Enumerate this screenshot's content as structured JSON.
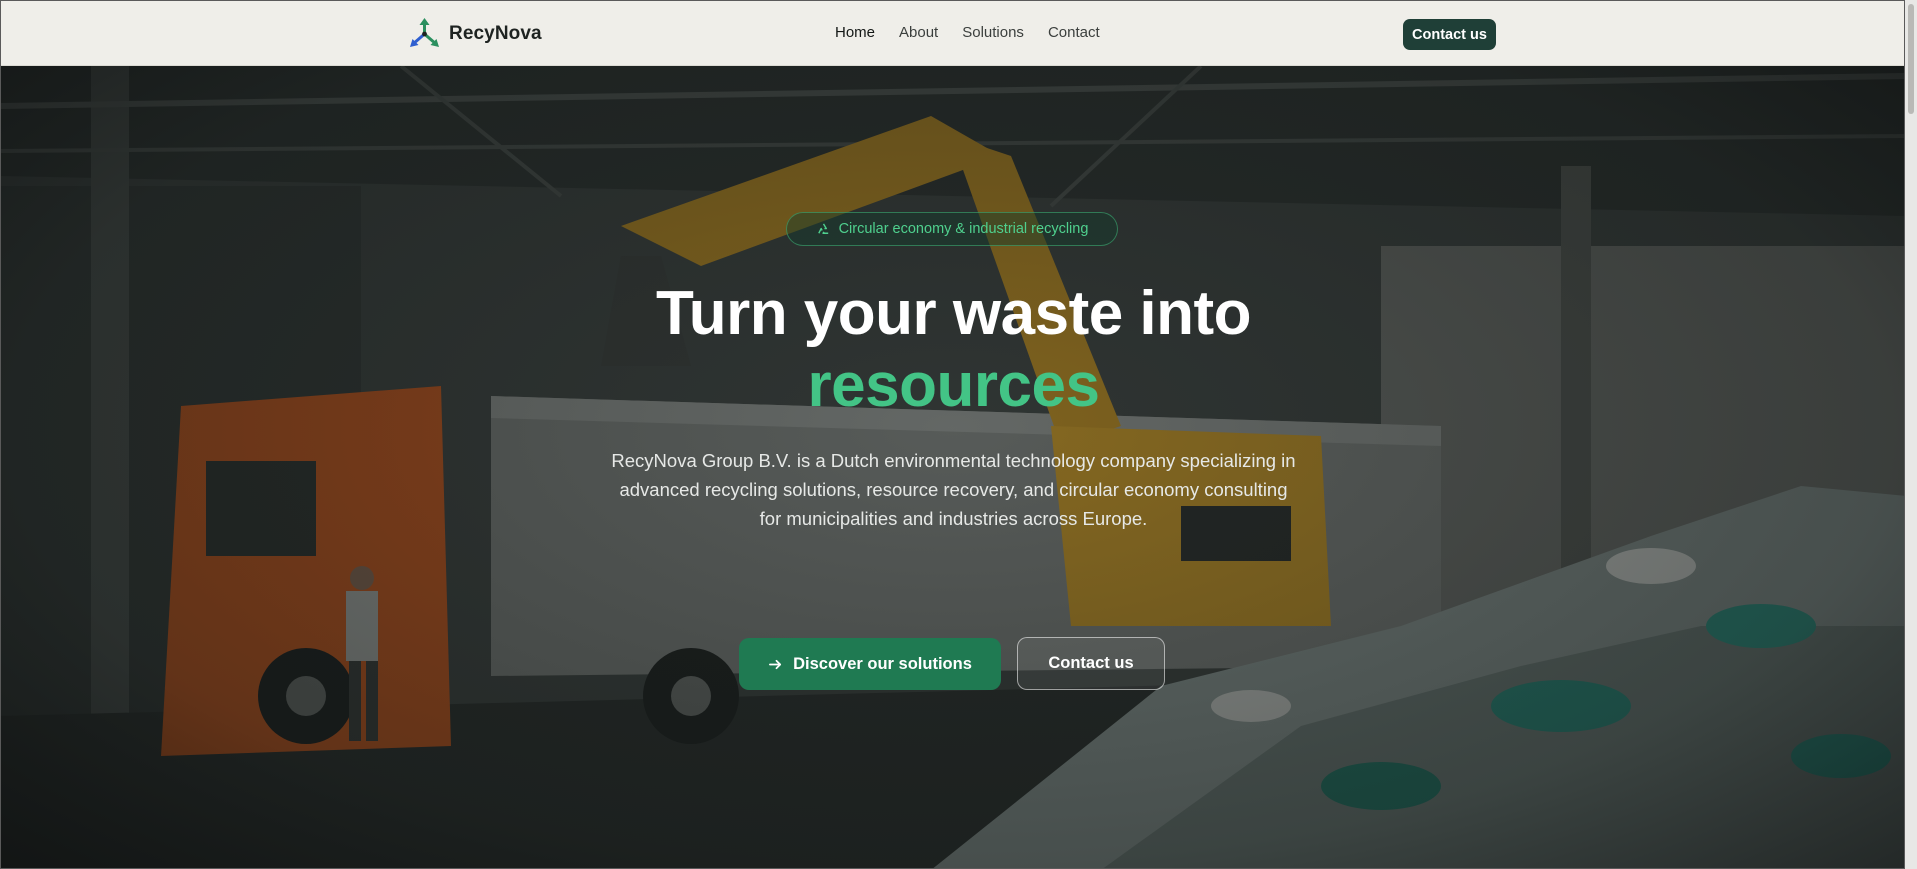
{
  "header": {
    "brand": "RecyNova",
    "nav": [
      {
        "label": "Home",
        "active": true
      },
      {
        "label": "About",
        "active": false
      },
      {
        "label": "Solutions",
        "active": false
      },
      {
        "label": "Contact",
        "active": false
      }
    ],
    "cta_label": "Contact us"
  },
  "hero": {
    "badge": "Circular economy & industrial recycling",
    "title_line1": "Turn your waste into",
    "title_line2": "resources",
    "description": "RecyNova Group B.V. is a Dutch environmental technology company specializing in advanced recycling solutions, resource recovery, and circular economy consulting for municipalities and industries across Europe.",
    "primary_button": "Discover our solutions",
    "secondary_button": "Contact us"
  },
  "colors": {
    "accent_green": "#43c486",
    "button_green": "#1f7a52",
    "header_cta": "#1f3f37",
    "header_bg": "#efeee9"
  },
  "icons": {
    "logo": "recycle-arrows-logo-icon",
    "badge": "recycle-icon",
    "primary_button": "arrow-right-icon"
  }
}
